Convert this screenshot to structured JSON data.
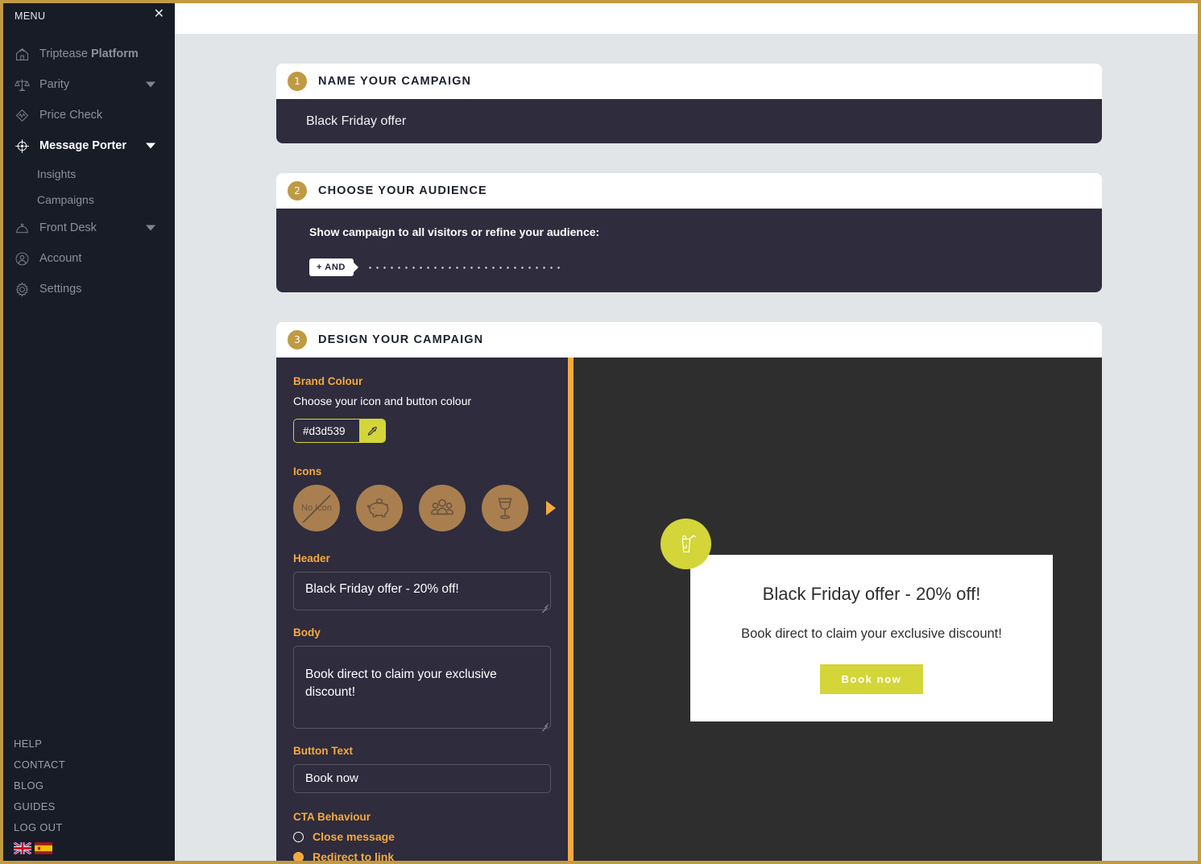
{
  "sidebar": {
    "menu_title": "MENU",
    "close_icon": "close-icon",
    "items": [
      {
        "label_light": "Triptease ",
        "label_bold": "Platform",
        "icon": "home-icon",
        "caret": false,
        "active": false
      },
      {
        "label_light": "Parity",
        "label_bold": "",
        "icon": "scales-icon",
        "caret": true,
        "active": false
      },
      {
        "label_light": "Price Check",
        "label_bold": "",
        "icon": "price-check-icon",
        "caret": false,
        "active": false
      },
      {
        "label_light": "",
        "label_bold": "Message Porter",
        "icon": "target-icon",
        "caret": true,
        "active": true
      }
    ],
    "sub_items": [
      "Insights",
      "Campaigns"
    ],
    "items_after": [
      {
        "label_light": "Front Desk",
        "label_bold": "",
        "icon": "bell-icon",
        "caret": true,
        "active": false
      },
      {
        "label_light": "Account",
        "label_bold": "",
        "icon": "account-icon",
        "caret": false,
        "active": false
      },
      {
        "label_light": "Settings",
        "label_bold": "",
        "icon": "gear-icon",
        "caret": false,
        "active": false
      }
    ],
    "footer_links": [
      "HELP",
      "CONTACT",
      "BLOG",
      "GUIDES",
      "LOG OUT"
    ],
    "flags": [
      "uk-flag",
      "spain-flag"
    ]
  },
  "steps": {
    "step1": {
      "number": "1",
      "title": "NAME YOUR CAMPAIGN",
      "campaign_name": "Black Friday offer"
    },
    "step2": {
      "number": "2",
      "title": "CHOOSE YOUR AUDIENCE",
      "audience_label": "Show campaign to all visitors or refine your audience:",
      "and_button": "+ AND"
    },
    "step3": {
      "number": "3",
      "title": "DESIGN YOUR CAMPAIGN",
      "brand_colour_label": "Brand Colour",
      "brand_colour_sub": "Choose your icon and button colour",
      "brand_colour_value": "#d3d539",
      "eyedropper_icon": "eyedropper-icon",
      "icons_label": "Icons",
      "icon_options": [
        {
          "name": "no-icon",
          "label": "No Icon"
        },
        {
          "name": "piggy-bank-icon",
          "label": ""
        },
        {
          "name": "people-group-icon",
          "label": ""
        },
        {
          "name": "wine-glass-icon",
          "label": ""
        }
      ],
      "icons_next_arrow": "chevron-right-icon",
      "header_label": "Header",
      "header_value": "Black Friday offer - 20% off!",
      "body_label": "Body",
      "body_value": "Book direct to claim your exclusive discount!",
      "button_text_label": "Button Text",
      "button_text_value": "Book now",
      "cta_label": "CTA Behaviour",
      "cta_options": [
        {
          "label": "Close message",
          "selected": false
        },
        {
          "label": "Redirect to link",
          "selected": true
        }
      ]
    }
  },
  "preview": {
    "badge_icon": "cocktail-icon",
    "title": "Black Friday offer - 20% off!",
    "body": "Book direct to claim your exclusive discount!",
    "button": "Book now"
  },
  "colors": {
    "frame_gold": "#c19a43",
    "sidebar_bg": "#171c27",
    "card_dark": "#2e2c3d",
    "accent_orange": "#f5a93f",
    "brand_lime": "#d3d539",
    "step_badge": "#bf9a43",
    "page_bg": "#e1e5e8"
  }
}
